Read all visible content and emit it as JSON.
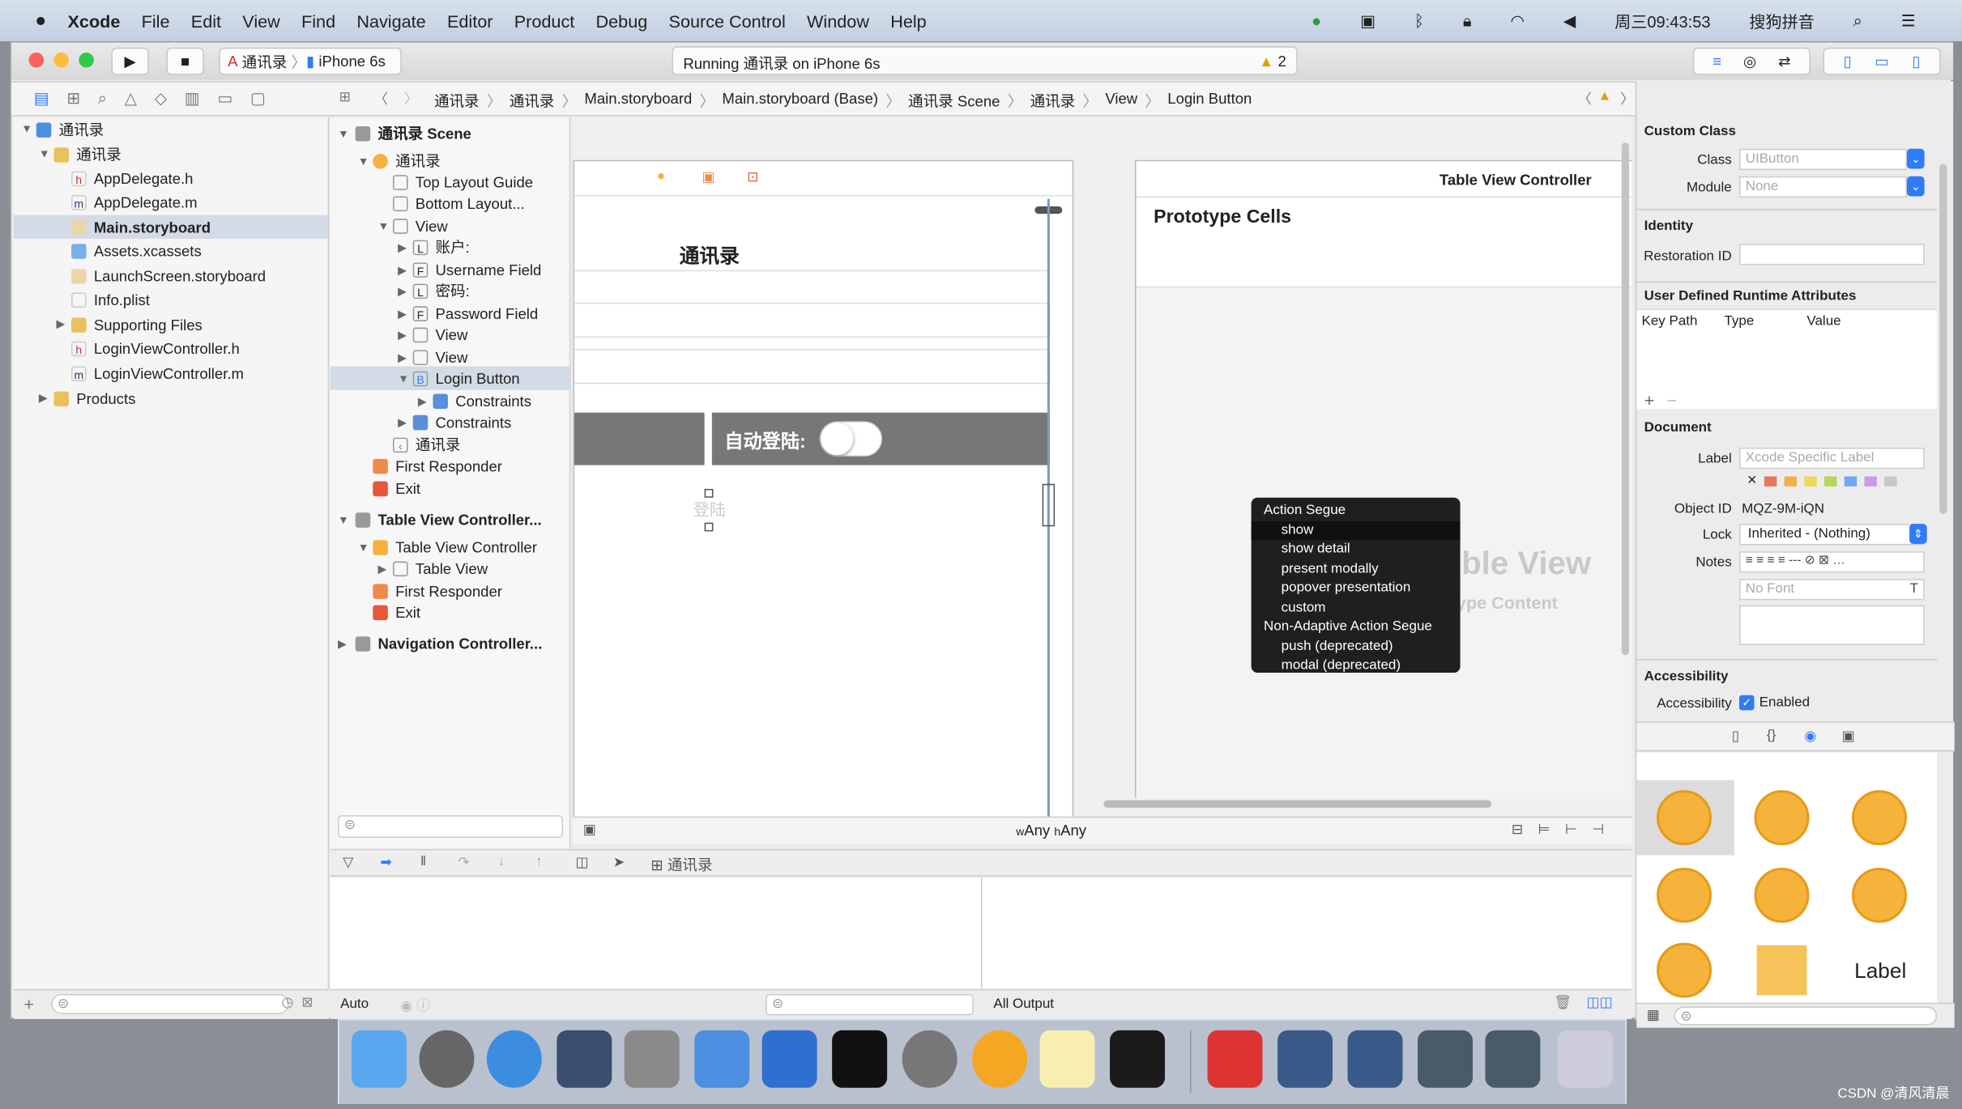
{
  "menubar": {
    "apple": "",
    "items": [
      "Xcode",
      "File",
      "Edit",
      "View",
      "Find",
      "Navigate",
      "Editor",
      "Product",
      "Debug",
      "Source Control",
      "Window",
      "Help"
    ],
    "clock": "周三09:43:53",
    "ime": "搜狗拼音"
  },
  "toolbar": {
    "scheme": "通讯录",
    "device": "iPhone 6s",
    "activity": "Running 通讯录 on iPhone 6s",
    "warnings": "2"
  },
  "jumpbar": {
    "crumbs": [
      "通讯录",
      "通讯录",
      "Main.storyboard",
      "Main.storyboard (Base)",
      "通讯录 Scene",
      "通讯录",
      "View",
      "Login Button"
    ]
  },
  "navigator": {
    "items": [
      {
        "label": "通讯录",
        "type": "project"
      },
      {
        "label": "通讯录",
        "type": "folder"
      },
      {
        "label": "AppDelegate.h",
        "type": "h"
      },
      {
        "label": "AppDelegate.m",
        "type": "m"
      },
      {
        "label": "Main.storyboard",
        "type": "storyboard",
        "selected": true
      },
      {
        "label": "Assets.xcassets",
        "type": "assets"
      },
      {
        "label": "LaunchScreen.storyboard",
        "type": "storyboard"
      },
      {
        "label": "Info.plist",
        "type": "plist"
      },
      {
        "label": "Supporting Files",
        "type": "folder"
      },
      {
        "label": "LoginViewController.h",
        "type": "h"
      },
      {
        "label": "LoginViewController.m",
        "type": "m"
      },
      {
        "label": "Products",
        "type": "folder"
      }
    ]
  },
  "outline": {
    "items": [
      {
        "label": "通讯录 Scene",
        "bold": true
      },
      {
        "label": "通讯录"
      },
      {
        "label": "Top Layout Guide"
      },
      {
        "label": "Bottom Layout..."
      },
      {
        "label": "View"
      },
      {
        "label": "账户:",
        "glyph": "L"
      },
      {
        "label": "Username Field",
        "glyph": "F"
      },
      {
        "label": "密码:",
        "glyph": "L"
      },
      {
        "label": "Password Field",
        "glyph": "F"
      },
      {
        "label": "View"
      },
      {
        "label": "View"
      },
      {
        "label": "Login Button",
        "glyph": "B",
        "selected": true
      },
      {
        "label": "Constraints"
      },
      {
        "label": "Constraints"
      },
      {
        "label": "通讯录"
      },
      {
        "label": "First Responder"
      },
      {
        "label": "Exit"
      },
      {
        "label": "Table View Controller...",
        "bold": true
      },
      {
        "label": "Table View Controller"
      },
      {
        "label": "Table View"
      },
      {
        "label": "First Responder"
      },
      {
        "label": "Exit"
      },
      {
        "label": "Navigation Controller...",
        "bold": true
      }
    ]
  },
  "canvas": {
    "nav_title": "通讯录",
    "auto_login": "自动登陆:",
    "login_button": "登陆",
    "tvc_title": "Table View Controller",
    "prototype_cells": "Prototype Cells",
    "table_view_ghost": "ble View",
    "prototype_content_ghost": "ype Content",
    "size_class_w": "Any",
    "size_class_h": "Any",
    "w": "w",
    "h": "h"
  },
  "segue_menu": {
    "items": [
      {
        "label": "Action Segue",
        "header": true
      },
      {
        "label": "show",
        "highlighted": true
      },
      {
        "label": "show detail"
      },
      {
        "label": "present modally"
      },
      {
        "label": "popover presentation"
      },
      {
        "label": "custom"
      },
      {
        "label": "Non-Adaptive Action Segue",
        "header": true
      },
      {
        "label": "push (deprecated)"
      },
      {
        "label": "modal (deprecated)"
      }
    ]
  },
  "inspector": {
    "custom_class": "Custom Class",
    "class_label": "Class",
    "class_placeholder": "UIButton",
    "module_label": "Module",
    "module_placeholder": "None",
    "identity": "Identity",
    "restoration_label": "Restoration ID",
    "udra": "User Defined Runtime Attributes",
    "col_key": "Key Path",
    "col_type": "Type",
    "col_value": "Value",
    "document": "Document",
    "label_label": "Label",
    "label_placeholder": "Xcode Specific Label",
    "object_id_label": "Object ID",
    "object_id": "MQZ-9M-iQN",
    "lock_label": "Lock",
    "lock_value": "Inherited - (Nothing)",
    "notes_label": "Notes",
    "font_placeholder": "No Font",
    "accessibility": "Accessibility",
    "accessibility_label": "Accessibility",
    "enabled": "Enabled",
    "enabled_checked": true,
    "library_label": "Label",
    "label_colors": [
      "#e8735e",
      "#f2b04b",
      "#efd85a",
      "#b8d45a",
      "#6fa8f2",
      "#c79be6",
      "#c8c8c8"
    ]
  },
  "debug": {
    "scheme": "通讯录",
    "auto": "Auto",
    "output": "All Output"
  },
  "watermark": "CSDN @清风清晨"
}
